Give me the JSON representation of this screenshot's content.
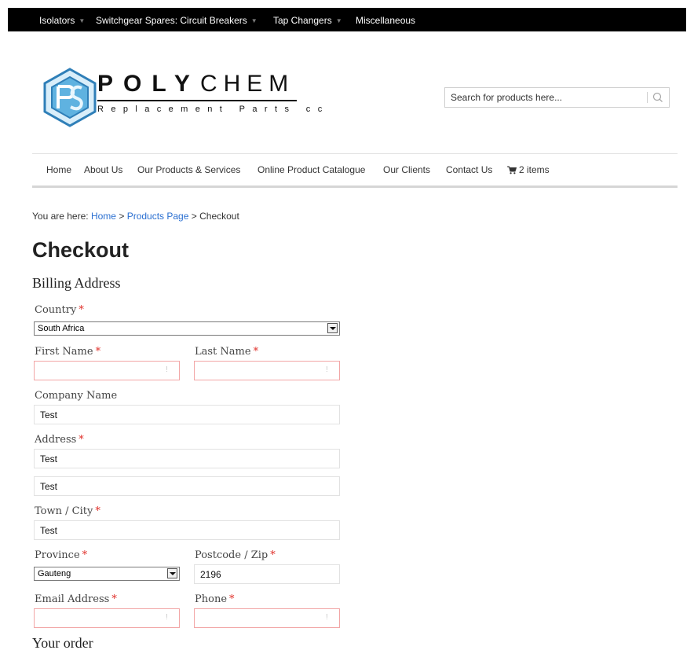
{
  "topbar": {
    "items": [
      {
        "label": "Isolators",
        "dropdown": true
      },
      {
        "label": "Switchgear Spares: Circuit Breakers",
        "dropdown": true
      },
      {
        "label": "Tap Changers",
        "dropdown": true
      },
      {
        "label": "Miscellaneous",
        "dropdown": false
      }
    ],
    "caret": "▼"
  },
  "logo": {
    "word_bold": "POLY",
    "word_thin": "CHEM",
    "tagline": "Replacement Parts cc",
    "colors": {
      "primary": "#2f7fb8",
      "light": "#cfe7f6",
      "accent": "#5fb2e0"
    }
  },
  "search": {
    "placeholder": "Search for products here...",
    "icon": "search-icon"
  },
  "nav": {
    "items": [
      "Home",
      "About Us",
      "Our Products & Services",
      "Online Product Catalogue",
      "Our Clients",
      "Contact Us"
    ],
    "cart_label": "2 items",
    "cart_icon": "cart-icon"
  },
  "breadcrumb": {
    "prefix": "You are here:",
    "home": "Home",
    "sep": ">",
    "products": "Products Page",
    "current": "Checkout"
  },
  "page_title": "Checkout",
  "billing": {
    "title": "Billing Address",
    "required_mark": "*",
    "invalid_mark": "!",
    "country": {
      "label": "Country",
      "value": "South Africa"
    },
    "first_name": {
      "label": "First Name",
      "value": ""
    },
    "last_name": {
      "label": "Last Name",
      "value": ""
    },
    "company": {
      "label": "Company Name",
      "value": "Test"
    },
    "address": {
      "label": "Address",
      "line1": "Test",
      "line2": "Test"
    },
    "town": {
      "label": "Town / City",
      "value": "Test"
    },
    "province": {
      "label": "Province",
      "value": "Gauteng"
    },
    "postcode": {
      "label": "Postcode / Zip",
      "value": "2196"
    },
    "email": {
      "label": "Email Address",
      "value": ""
    },
    "phone": {
      "label": "Phone",
      "value": ""
    }
  },
  "order": {
    "title": "Your order"
  },
  "colors": {
    "link": "#2a6fd1",
    "required": "#e0312b",
    "invalid_border": "#f2a6a6",
    "topbar": "#000000"
  }
}
